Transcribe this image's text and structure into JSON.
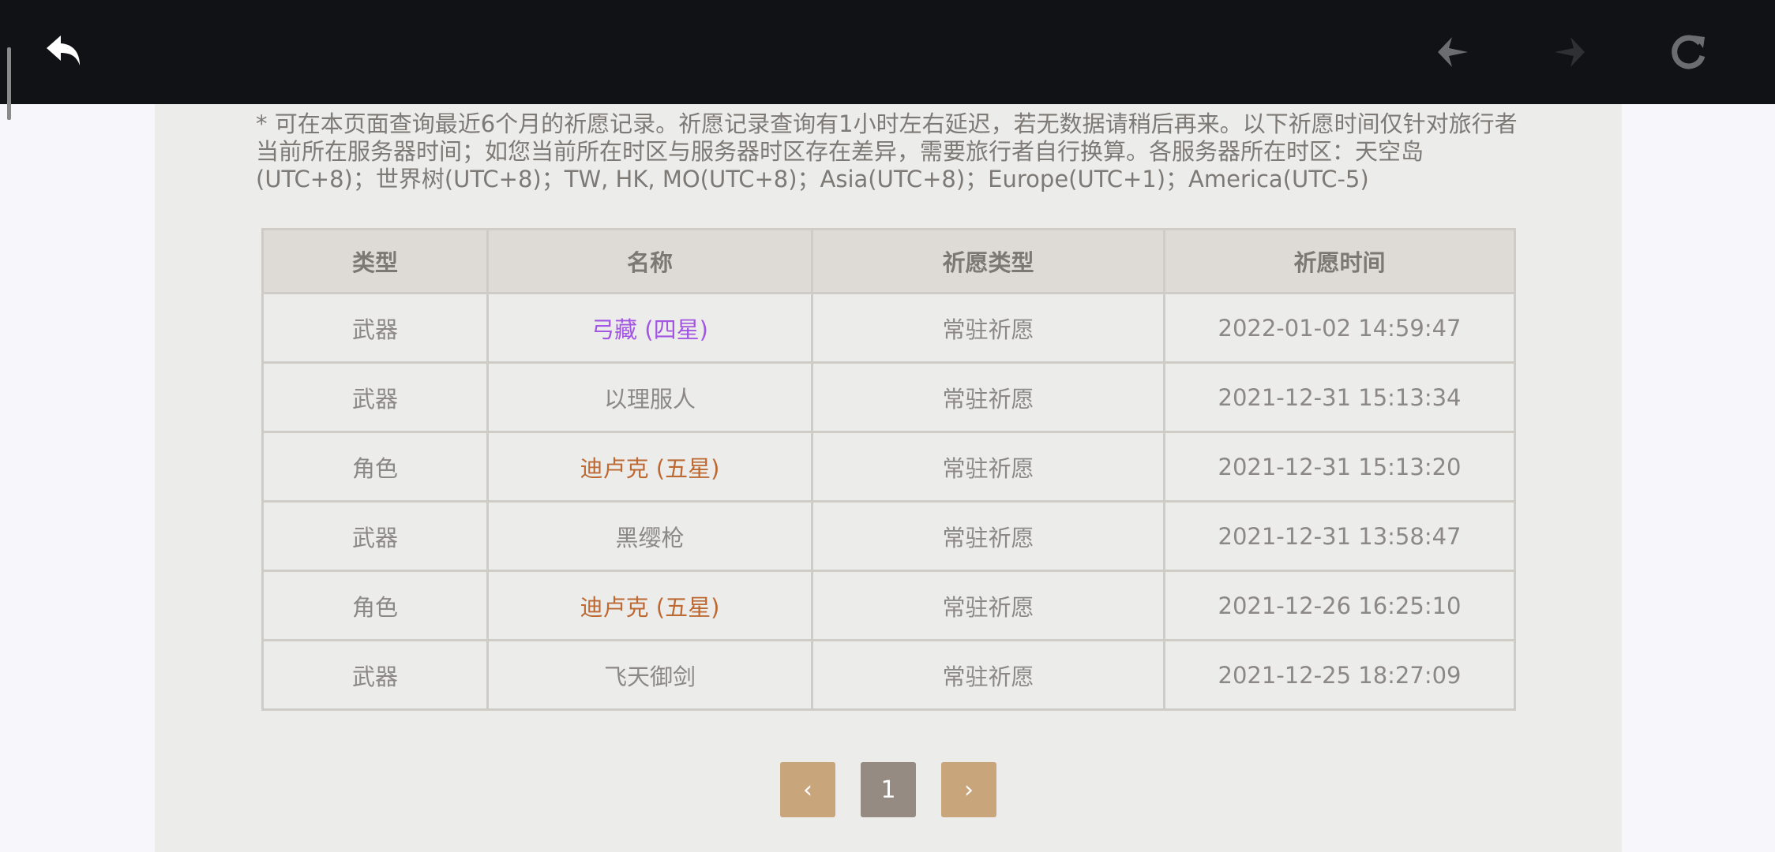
{
  "topbar": {
    "icons": {
      "back": "back-arrow-icon",
      "prev": "nav-prev-icon",
      "next": "nav-next-icon",
      "refresh": "refresh-icon"
    }
  },
  "notice": "* 可在本页面查询最近6个月的祈愿记录。祈愿记录查询有1小时左右延迟，若无数据请稍后再来。以下祈愿时间仅针对旅行者当前所在服务器时间；如您当前所在时区与服务器时区存在差异，需要旅行者自行换算。各服务器所在时区：天空岛(UTC+8)；世界树(UTC+8)；TW, HK, MO(UTC+8)；Asia(UTC+8)；Europe(UTC+1)；America(UTC-5)",
  "table": {
    "headers": [
      "类型",
      "名称",
      "祈愿类型",
      "祈愿时间"
    ],
    "rows": [
      {
        "type": "武器",
        "name": "弓藏 (四星)",
        "wish": "常驻祈愿",
        "time": "2022-01-02 14:59:47",
        "color": "#a256e1"
      },
      {
        "type": "武器",
        "name": "以理服人",
        "wish": "常驻祈愿",
        "time": "2021-12-31 15:13:34",
        "color": "#8b8885"
      },
      {
        "type": "角色",
        "name": "迪卢克 (五星)",
        "wish": "常驻祈愿",
        "time": "2021-12-31 15:13:20",
        "color": "#bd6932"
      },
      {
        "type": "武器",
        "name": "黑缨枪",
        "wish": "常驻祈愿",
        "time": "2021-12-31 13:58:47",
        "color": "#8b8885"
      },
      {
        "type": "角色",
        "name": "迪卢克 (五星)",
        "wish": "常驻祈愿",
        "time": "2021-12-26 16:25:10",
        "color": "#bd6932"
      },
      {
        "type": "武器",
        "name": "飞天御剑",
        "wish": "常驻祈愿",
        "time": "2021-12-25 18:27:09",
        "color": "#8b8885"
      }
    ]
  },
  "pager": {
    "prev": "‹",
    "current": "1",
    "next": "›"
  },
  "colors": {
    "topbar": "#111215",
    "page": "#ececeb",
    "header_bg": "#dedbd6",
    "four_star": "#a256e1",
    "five_star": "#bd6932",
    "pager_arrow": "#c9a57c",
    "pager_current": "#958b83"
  }
}
